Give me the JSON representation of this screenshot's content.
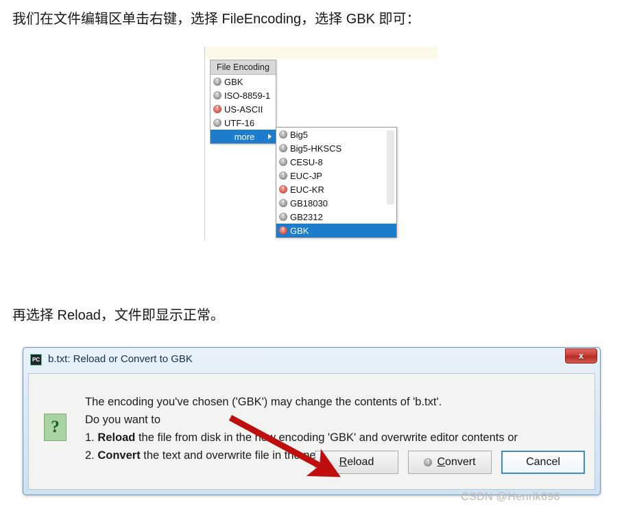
{
  "paragraphs": {
    "top": "我们在文件编辑区单击右键，选择 FileEncoding，选择 GBK 即可：",
    "middle": "再选择 Reload，文件即显示正常。"
  },
  "context_menu": {
    "header": "File Encoding",
    "items": [
      {
        "label": "GBK",
        "icon": "warning-gray-icon",
        "severity": "gray",
        "selected": false
      },
      {
        "label": "ISO-8859-1",
        "icon": "warning-gray-icon",
        "severity": "gray",
        "selected": false
      },
      {
        "label": "US-ASCII",
        "icon": "warning-red-icon",
        "severity": "red",
        "selected": false
      },
      {
        "label": "UTF-16",
        "icon": "warning-gray-icon",
        "severity": "gray",
        "selected": false
      },
      {
        "label": "more",
        "icon": "submenu-arrow-icon",
        "severity": "none",
        "selected": true
      }
    ]
  },
  "submenu": {
    "items": [
      {
        "label": "Big5",
        "icon": "warning-gray-icon",
        "severity": "gray",
        "selected": false
      },
      {
        "label": "Big5-HKSCS",
        "icon": "warning-gray-icon",
        "severity": "gray",
        "selected": false
      },
      {
        "label": "CESU-8",
        "icon": "warning-gray-icon",
        "severity": "gray",
        "selected": false
      },
      {
        "label": "EUC-JP",
        "icon": "warning-gray-icon",
        "severity": "gray",
        "selected": false
      },
      {
        "label": "EUC-KR",
        "icon": "warning-red-icon",
        "severity": "red",
        "selected": false
      },
      {
        "label": "GB18030",
        "icon": "warning-gray-icon",
        "severity": "gray",
        "selected": false
      },
      {
        "label": "GB2312",
        "icon": "warning-gray-icon",
        "severity": "gray",
        "selected": false
      },
      {
        "label": "GBK",
        "icon": "warning-red-icon",
        "severity": "red",
        "selected": true
      }
    ]
  },
  "dialog": {
    "app_icon_label": "PC",
    "title": "b.txt: Reload or Convert to GBK",
    "close_label": "x",
    "question_icon_label": "?",
    "message_lines": [
      {
        "prefix": "",
        "bold": "",
        "rest": "The encoding you've chosen ('GBK') may change the contents of 'b.txt'."
      },
      {
        "prefix": "",
        "bold": "",
        "rest": "Do you want to"
      },
      {
        "prefix": "1. ",
        "bold": "Reload",
        "rest": " the file from disk in the new encoding 'GBK' and overwrite editor contents or"
      },
      {
        "prefix": "2. ",
        "bold": "Convert",
        "rest": " the text and overwrite file in the new encoding?"
      }
    ],
    "buttons": [
      {
        "label_before": "",
        "mnemonic": "R",
        "label_after": "eload",
        "icon": "none",
        "focused": false
      },
      {
        "label_before": "",
        "mnemonic": "C",
        "label_after": "onvert",
        "icon": "warning-gray-icon",
        "focused": false
      },
      {
        "label_before": "Cancel",
        "mnemonic": "",
        "label_after": "",
        "icon": "none",
        "focused": true
      }
    ]
  },
  "annotation": {
    "arrow_color": "#c00d0d"
  },
  "watermark": "CSDN @Henrik698",
  "colors": {
    "menu_highlight": "#1d7dcc",
    "dialog_frame": "#6f95b5",
    "close_button": "#c73a32",
    "question_icon": "#a8d3a2"
  }
}
